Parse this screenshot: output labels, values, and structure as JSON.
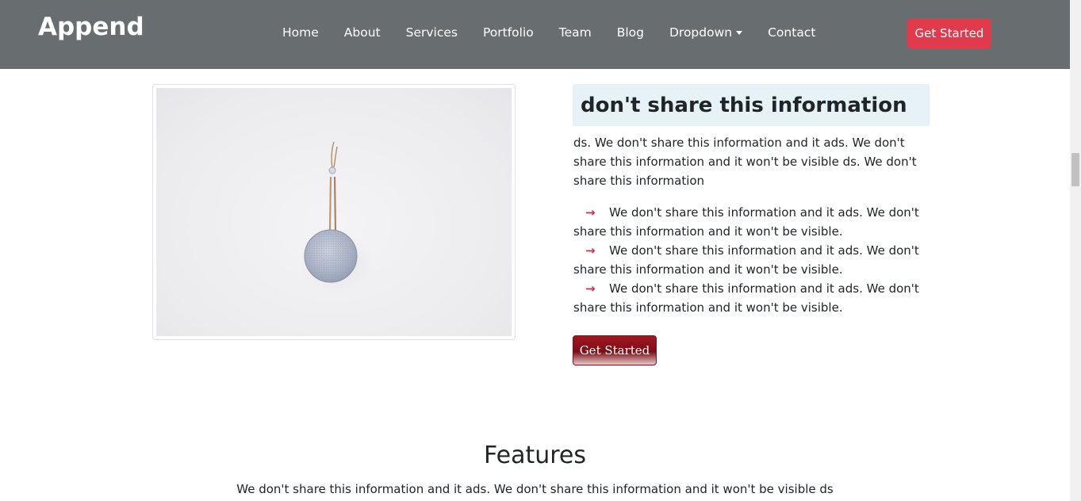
{
  "header": {
    "logo": "Append",
    "nav": [
      "Home",
      "About",
      "Services",
      "Portfolio",
      "Team",
      "Blog",
      "Dropdown",
      "Contact"
    ],
    "cta_label": "Get Started"
  },
  "about": {
    "heading": "don't share this information",
    "paragraph": "ds. We don't share this information and it ads. We don't share this information and it won't be visible ds. We don't share this information",
    "bullets": [
      "We don't share this information and it ads. We don't share this information and it won't be visible.",
      "We don't share this information and it ads. We don't share this information and it won't be visible.",
      "We don't share this information and it ads. We don't share this information and it won't be visible."
    ],
    "arrow_glyph": "→",
    "cta_label": "Get Started"
  },
  "features": {
    "title": "Features",
    "subtitle": "We don't share this information and it ads. We don't share this information and it won't be visible ds"
  },
  "colors": {
    "header_bg": "#686e6f",
    "accent": "#e03a4c",
    "arrow": "#d9303f",
    "heading_box_bg": "#e6f2f5",
    "cta_dark": "#7c0e16"
  },
  "icons": [
    "arrow-right-icon",
    "caret-down-icon",
    "speaker-image"
  ]
}
